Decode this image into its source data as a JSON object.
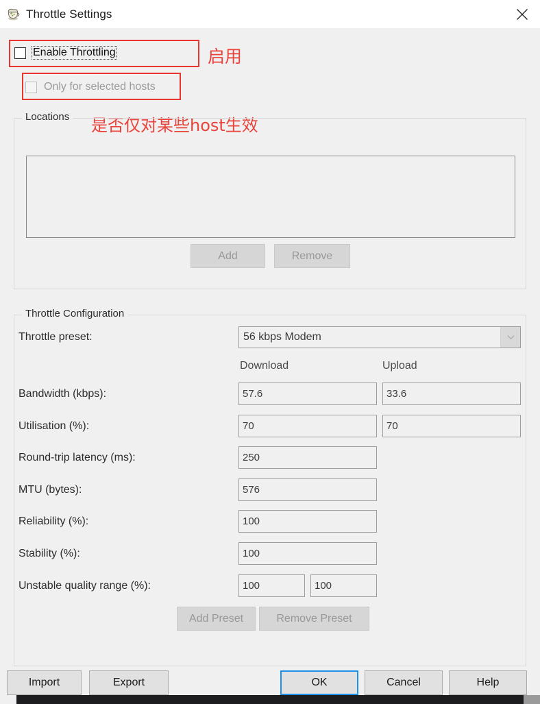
{
  "window": {
    "title": "Throttle Settings",
    "icon": "charles-jug-icon",
    "close_icon": "close-icon"
  },
  "options": {
    "enable_throttling": {
      "label": "Enable Throttling",
      "checked": false,
      "focused": true
    },
    "only_selected_hosts": {
      "label": "Only for selected hosts",
      "checked": false,
      "disabled": true
    }
  },
  "annotations": {
    "accent_color": "#e8352e",
    "enable_note": "启用",
    "hosts_note": "是否仅对某些host生效"
  },
  "locations": {
    "group_title": "Locations",
    "items": [],
    "add_label": "Add",
    "remove_label": "Remove",
    "add_disabled": true,
    "remove_disabled": true
  },
  "throttle_configuration": {
    "group_title": "Throttle Configuration",
    "preset_label": "Throttle preset:",
    "preset_value": "56 kbps Modem",
    "preset_options": [
      "56 kbps Modem"
    ],
    "columns": [
      "Download",
      "Upload"
    ],
    "rows": [
      {
        "label": "Bandwidth (kbps):",
        "download": "57.6",
        "upload": "33.6",
        "has_upload": true
      },
      {
        "label": "Utilisation (%):",
        "download": "70",
        "upload": "70",
        "has_upload": true
      },
      {
        "label": "Round-trip latency (ms):",
        "download": "250",
        "upload": "",
        "has_upload": false
      },
      {
        "label": "MTU (bytes):",
        "download": "576",
        "upload": "",
        "has_upload": false
      },
      {
        "label": "Reliability (%):",
        "download": "100",
        "upload": "",
        "has_upload": false
      },
      {
        "label": "Stability (%):",
        "download": "100",
        "upload": "",
        "has_upload": false
      }
    ],
    "unstable_row": {
      "label": "Unstable quality range (%):",
      "min": "100",
      "max": "100"
    },
    "add_preset_label": "Add Preset",
    "remove_preset_label": "Remove Preset",
    "add_preset_disabled": true,
    "remove_preset_disabled": true
  },
  "footer": {
    "import_label": "Import",
    "export_label": "Export",
    "ok_label": "OK",
    "cancel_label": "Cancel",
    "help_label": "Help",
    "default_button": "OK"
  }
}
